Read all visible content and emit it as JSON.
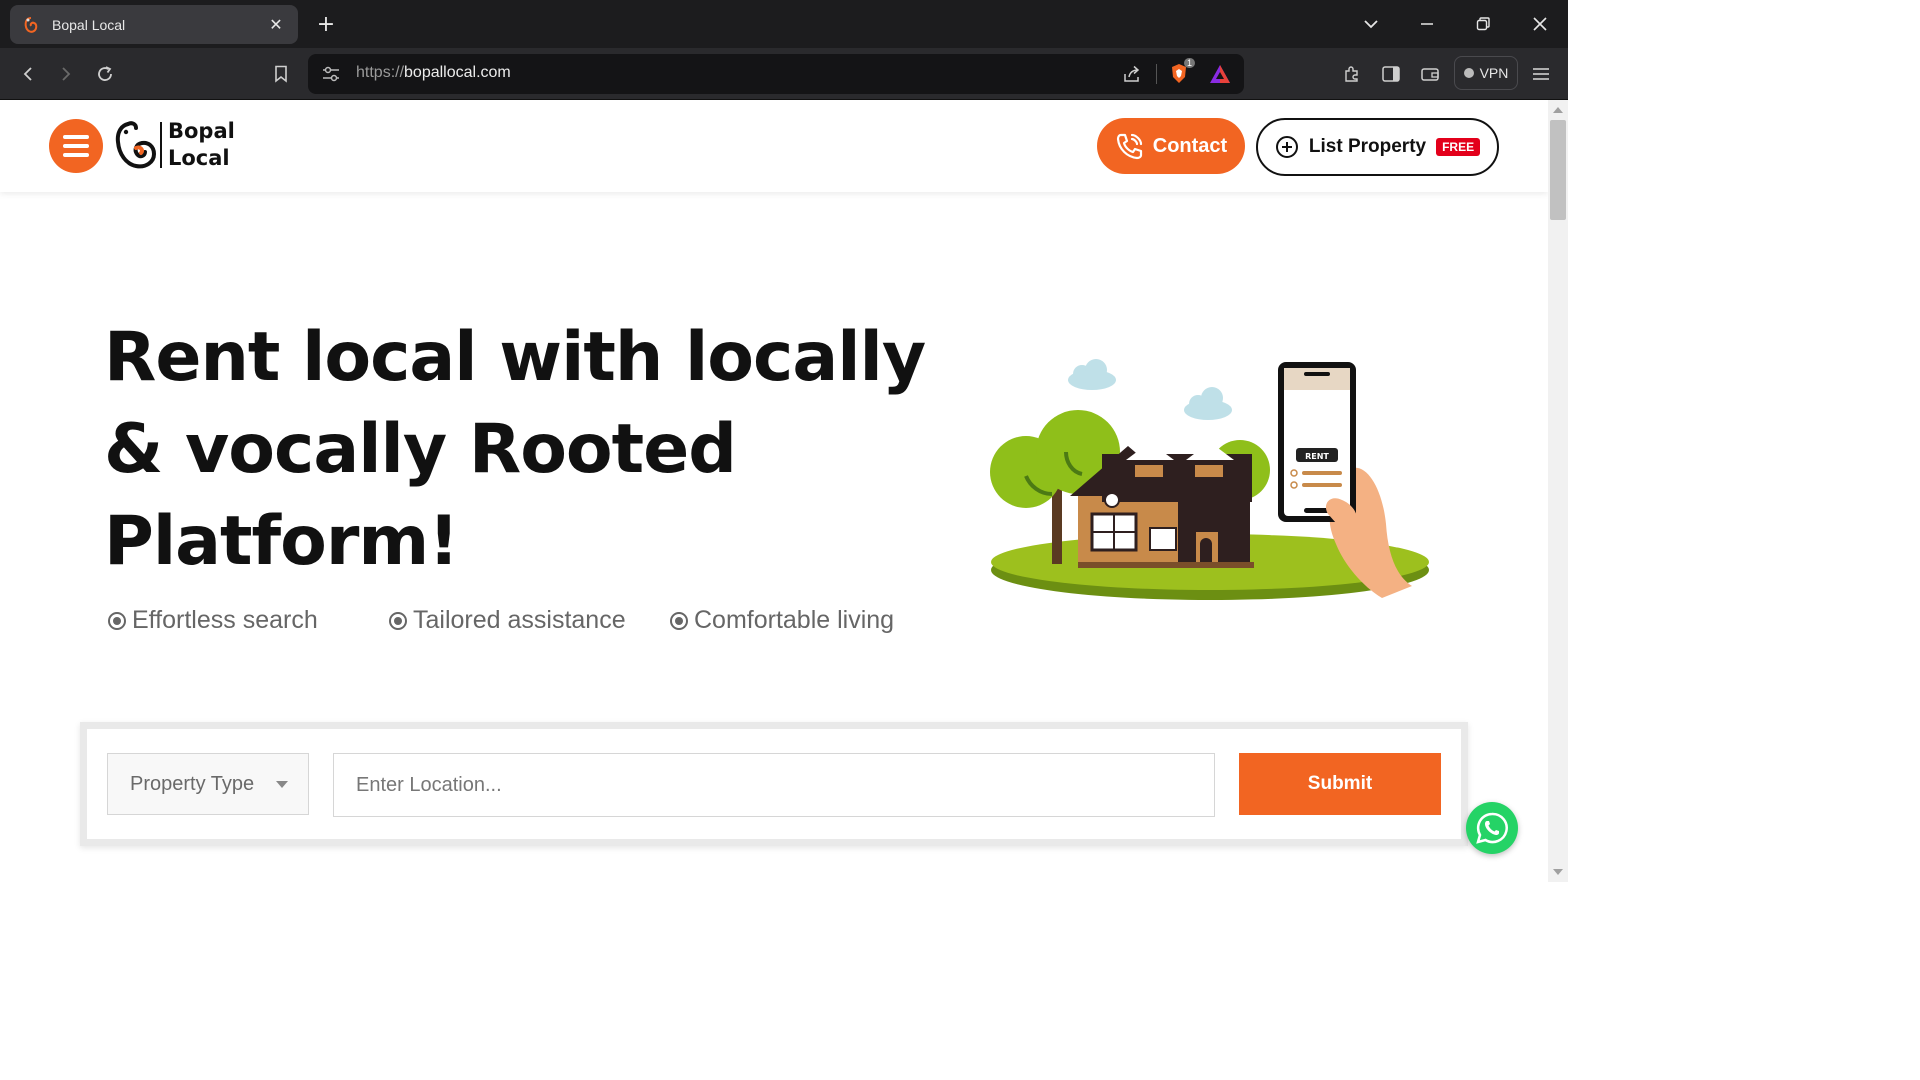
{
  "browser": {
    "tab_title": "Bopal Local",
    "tab_close": "✕",
    "new_tab": "+",
    "url_scheme": "https://",
    "url_host": "bopallocal.com",
    "brave_badge_count": "1",
    "vpn_label": "VPN"
  },
  "header": {
    "logo_line1": "Bopal",
    "logo_line2": "Local",
    "contact_label": "Contact",
    "list_property_label": "List Property",
    "free_badge": "FREE"
  },
  "hero": {
    "title": "Rent local with locally & vocally Rooted Platform!",
    "features": [
      "Effortless search",
      "Tailored assistance",
      "Comfortable living"
    ],
    "illustration_phone_label": "RENT"
  },
  "search": {
    "property_type_label": "Property Type",
    "location_placeholder": "Enter Location...",
    "location_value": "",
    "submit_label": "Submit"
  },
  "colors": {
    "accent": "#f26522",
    "free_badge": "#e3001b",
    "whatsapp": "#25d366"
  },
  "icons": {
    "menu": "hamburger-icon",
    "contact": "phone-icon",
    "list_property": "plus-circle-icon",
    "feature_bullet": "radio-dot-icon",
    "floating": "whatsapp-icon"
  }
}
